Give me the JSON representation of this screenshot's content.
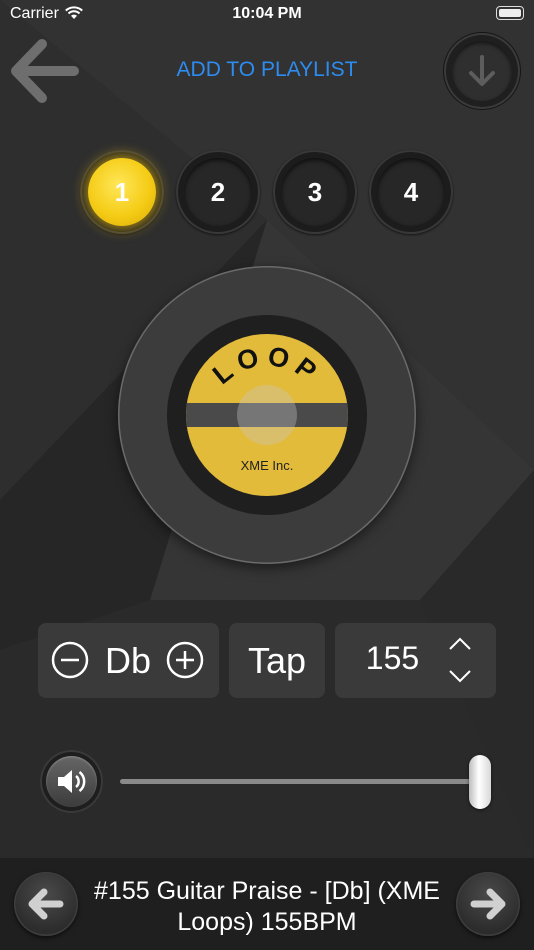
{
  "status_bar": {
    "carrier": "Carrier",
    "time": "10:04 PM"
  },
  "header": {
    "playlist_label": "ADD TO PLAYLIST"
  },
  "slots": [
    {
      "label": "1",
      "active": true
    },
    {
      "label": "2",
      "active": false
    },
    {
      "label": "3",
      "active": false
    },
    {
      "label": "4",
      "active": false
    }
  ],
  "record": {
    "title": "LOOP",
    "company": "XME Inc."
  },
  "controls": {
    "key": "Db",
    "tap_label": "Tap",
    "bpm": "155"
  },
  "volume": {
    "level": 1.0
  },
  "now_playing": {
    "title": "#155 Guitar Praise - [Db] (XME Loops) 155BPM"
  },
  "colors": {
    "accent_blue": "#2d8cf0",
    "active_yellow": "#f5cc16",
    "label_yellow": "#e2bb3a"
  },
  "icons": [
    "back-arrow-icon",
    "download-icon",
    "minus-circle-icon",
    "plus-circle-icon",
    "chevron-up-icon",
    "chevron-down-icon",
    "speaker-icon",
    "previous-arrow-icon",
    "next-arrow-icon"
  ]
}
